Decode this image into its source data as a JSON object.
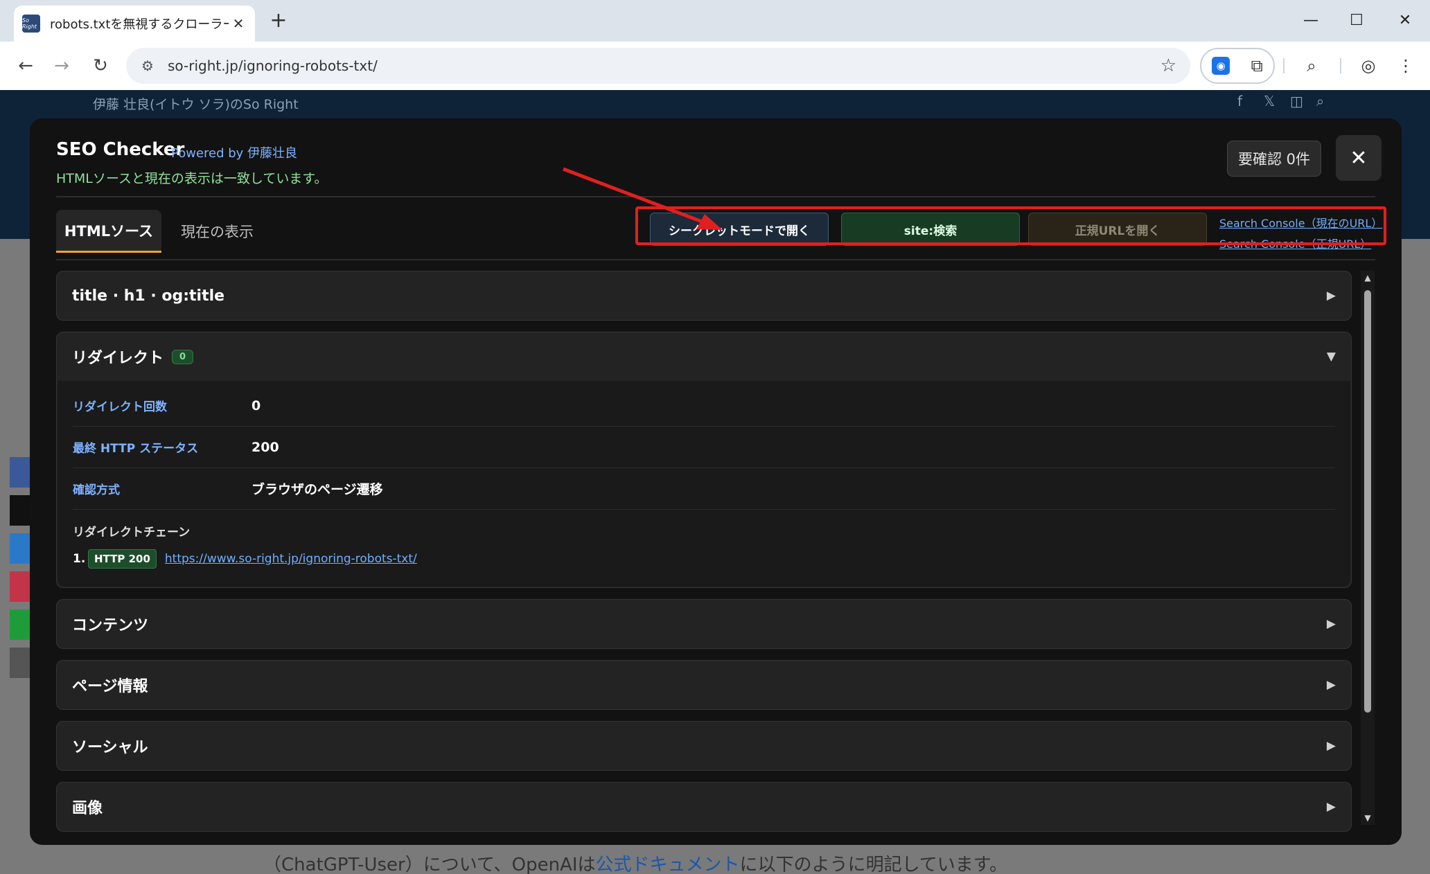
{
  "browser": {
    "tab_title": "robots.txtを無視するクローラーまとめ",
    "favicon_text": "So Right",
    "tab_close": "✕",
    "new_tab": "+",
    "url": "so-right.jp/ignoring-robots-txt/",
    "controls": {
      "minimize": "—",
      "maximize": "☐",
      "close": "✕"
    }
  },
  "page": {
    "tagline": "伊藤 壮良(イトウ ソラ)のSo Right",
    "bottom_text_pre": "（ChatGPT-User）について、OpenAIは",
    "bottom_link": "公式ドキュメント",
    "bottom_text_post": "に以下のように明記しています。"
  },
  "seo": {
    "title": "SEO Checker",
    "powered": "Powered by 伊藤壮良",
    "status": "HTMLソースと現在の表示は一致しています。",
    "review_button": "要確認 0件",
    "close_button": "✕",
    "tabs": {
      "html": "HTMLソース",
      "view": "現在の表示"
    },
    "actions": {
      "incognito": "シークレットモードで開く",
      "site_search": "site:検索",
      "canonical": "正規URLを開く",
      "sc_current": "Search Console（現在のURL）",
      "sc_canonical": "Search Console（正規URL）"
    },
    "sections": {
      "title_h1": "title · h1 · og:title",
      "redirect": "リダイレクト",
      "redirect_count_badge": "0",
      "content": "コンテンツ",
      "page_info": "ページ情報",
      "social": "ソーシャル",
      "images": "画像"
    },
    "redirect": {
      "rows": [
        {
          "key": "リダイレクト回数",
          "value": "0"
        },
        {
          "key": "最終 HTTP ステータス",
          "value": "200"
        },
        {
          "key": "確認方式",
          "value": "ブラウザのページ遷移"
        }
      ],
      "chain_label": "リダイレクトチェーン",
      "chain": [
        {
          "num": "1.",
          "status": "HTTP 200",
          "url": "https://www.so-right.jp/ignoring-robots-txt/"
        }
      ]
    },
    "arrow_collapsed": "▶",
    "arrow_expanded": "▼"
  },
  "colors": {
    "panel_bg": "#121212",
    "accent_tab": "#f0a030",
    "status_green": "#8fe39a",
    "link_blue": "#6fb0ff",
    "annotation_red": "#e02020"
  }
}
